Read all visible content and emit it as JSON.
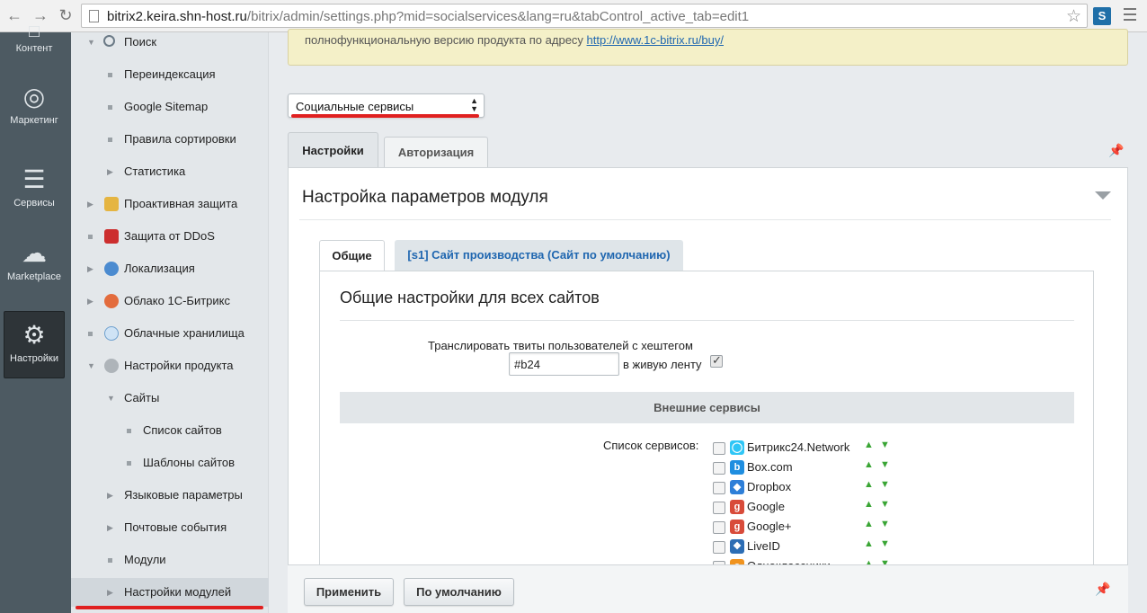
{
  "browser": {
    "url_host": "bitrix2.keira.shn-host.ru",
    "url_rest": "/bitrix/admin/settings.php?mid=socialservices&lang=ru&tabControl_active_tab=edit1",
    "extension_label": "S"
  },
  "left_panel": {
    "items": [
      {
        "label": "Контент",
        "icon": "content-icon"
      },
      {
        "label": "Маркетинг",
        "icon": "target-icon"
      },
      {
        "label": "Сервисы",
        "icon": "layers-icon"
      },
      {
        "label": "Marketplace",
        "icon": "cloud-download-icon"
      },
      {
        "label": "Настройки",
        "icon": "gear-icon",
        "active": true
      }
    ]
  },
  "tree": {
    "items": [
      {
        "label": "Поиск"
      },
      {
        "label": "Переиндексация"
      },
      {
        "label": "Google Sitemap"
      },
      {
        "label": "Правила сортировки"
      },
      {
        "label": "Статистика"
      },
      {
        "label": "Проактивная защита"
      },
      {
        "label": "Защита от DDoS"
      },
      {
        "label": "Локализация"
      },
      {
        "label": "Облако 1С-Битрикс"
      },
      {
        "label": "Облачные хранилища"
      },
      {
        "label": "Настройки продукта"
      },
      {
        "label": "Сайты"
      },
      {
        "label": "Список сайтов"
      },
      {
        "label": "Шаблоны сайтов"
      },
      {
        "label": "Языковые параметры"
      },
      {
        "label": "Почтовые события"
      },
      {
        "label": "Модули"
      },
      {
        "label": "Настройки модулей"
      }
    ]
  },
  "notice": {
    "text": "полнофункциональную версию продукта по адресу ",
    "link": "http://www.1c-bitrix.ru/buy/"
  },
  "module_select": {
    "value": "Социальные сервисы"
  },
  "top_tabs": [
    {
      "label": "Настройки"
    },
    {
      "label": "Авторизация"
    }
  ],
  "panel": {
    "title": "Настройка параметров модуля"
  },
  "inner_tabs": [
    {
      "label": "Общие"
    },
    {
      "label": "[s1] Сайт производства (Сайт по умолчанию)"
    }
  ],
  "general": {
    "title": "Общие настройки для всех сайтов",
    "tweet_label": "Транслировать твиты пользователей с хештегом",
    "hashtag_value": "#b24",
    "tweet_suffix": "в живую ленту",
    "tweet_checked": true
  },
  "external": {
    "heading": "Внешние сервисы",
    "list_label": "Список сервисов:",
    "services": [
      {
        "name": "Битрикс24.Network",
        "icon": "bitrix24-icon",
        "color": "#2fc6f6"
      },
      {
        "name": "Box.com",
        "icon": "box-icon",
        "color": "#1f8ee0"
      },
      {
        "name": "Dropbox",
        "icon": "dropbox-icon",
        "color": "#2e7fd8"
      },
      {
        "name": "Google",
        "icon": "google-icon",
        "color": "#d84b3a"
      },
      {
        "name": "Google+",
        "icon": "google-plus-icon",
        "color": "#d84b3a"
      },
      {
        "name": "LiveID",
        "icon": "liveid-icon",
        "color": "#2c6db4"
      },
      {
        "name": "Одноклассники",
        "icon": "odnoklassniki-icon",
        "color": "#f0931e"
      }
    ]
  },
  "buttons": {
    "apply": "Применить",
    "default": "По умолчанию"
  },
  "colors": {
    "accent_red": "#e02020",
    "link_blue": "#2067b0",
    "arrow_green": "#3aa535"
  }
}
